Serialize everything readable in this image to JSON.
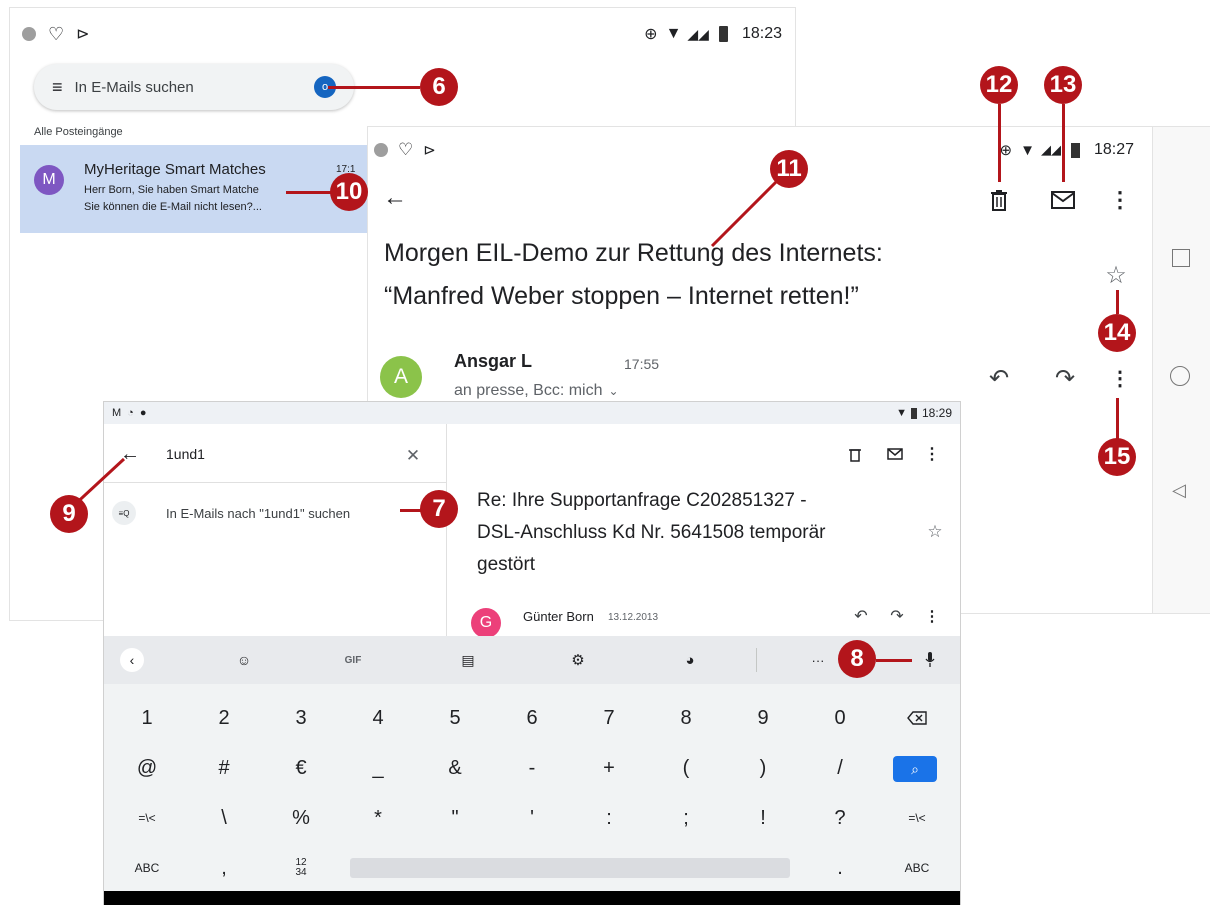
{
  "inbox": {
    "status_time": "18:23",
    "search_placeholder": "In E-Mails suchen",
    "avatar_badge": "o",
    "section_label": "Alle Posteingänge",
    "message": {
      "avatar_letter": "M",
      "sender": "MyHeritage Smart Matches",
      "time": "17:1",
      "line1": "Herr Born, Sie haben Smart Matche",
      "line2": "Sie können die E-Mail nicht lesen?..."
    }
  },
  "email_view": {
    "status_time": "18:27",
    "subject_line1": "Morgen EIL-Demo zur Rettung des Internets:",
    "subject_line2": "“Manfred Weber stoppen – Internet retten!”",
    "sender_avatar_letter": "A",
    "sender_name": "Ansgar L",
    "sender_time": "17:55",
    "recipients": "an presse, Bcc: mich"
  },
  "search_screen": {
    "status_time": "18:29",
    "query": "1und1",
    "suggestion": "In E-Mails nach \"1und1\" suchen",
    "email_subject_line1": "Re: Ihre Supportanfrage C202851327 -",
    "email_subject_line2": "DSL-Anschluss Kd Nr. 5641508 temporär",
    "email_subject_line3": "gestört",
    "sender_avatar_letter": "G",
    "sender_name": "Günter Born",
    "sender_date": "13.12.2013"
  },
  "keyboard": {
    "toolbar": {
      "gif": "GIF",
      "more": "···"
    },
    "row1": [
      "1",
      "2",
      "3",
      "4",
      "5",
      "6",
      "7",
      "8",
      "9",
      "0"
    ],
    "row2": [
      "@",
      "#",
      "€",
      "_",
      "&",
      "-",
      "+",
      "(",
      ")",
      "/"
    ],
    "row3": [
      "=\\<",
      "\\",
      "%",
      "*",
      "\"",
      "'",
      ":",
      ";",
      "!",
      "?",
      "=\\<"
    ],
    "row4": {
      "abc_left": "ABC",
      "comma": ",",
      "numpad_top": "12",
      "numpad_bottom": "34",
      "period": ".",
      "abc_right": "ABC"
    }
  },
  "callouts": [
    "6",
    "7",
    "8",
    "9",
    "10",
    "11",
    "12",
    "13",
    "14",
    "15"
  ],
  "colors": {
    "callout": "#b3151b",
    "highlight_row": "#c9d9f2",
    "avatar_m": "#7e57c2",
    "avatar_a": "#8bc34a",
    "avatar_g": "#ec407a",
    "search_key": "#1a73e8"
  }
}
